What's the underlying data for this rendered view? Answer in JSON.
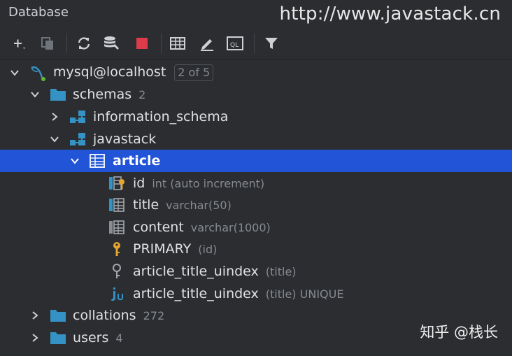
{
  "window": {
    "title": "Database",
    "watermark": "http://www.javastack.cn"
  },
  "toolbar": {
    "buttons": [
      {
        "icon": "plus-icon"
      },
      {
        "icon": "duplicate-icon"
      },
      {
        "icon": "refresh-icon"
      },
      {
        "icon": "data-source-properties-icon"
      },
      {
        "icon": "stop-icon"
      },
      {
        "icon": "table-view-icon"
      },
      {
        "icon": "edit-icon"
      },
      {
        "icon": "query-console-icon"
      },
      {
        "icon": "filter-icon"
      }
    ]
  },
  "tree": {
    "connection": {
      "label": "mysql@localhost",
      "badge": "2 of 5"
    },
    "schemas": {
      "label": "schemas",
      "count": "2"
    },
    "information_schema": {
      "label": "information_schema"
    },
    "javastack": {
      "label": "javastack"
    },
    "article": {
      "label": "article"
    },
    "columns": [
      {
        "name": "id",
        "type": "int (auto increment)"
      },
      {
        "name": "title",
        "type": "varchar(50)"
      },
      {
        "name": "content",
        "type": "varchar(1000)"
      }
    ],
    "primary": {
      "name": "PRIMARY",
      "detail": "(id)"
    },
    "key": {
      "name": "article_title_uindex",
      "detail": "(title)"
    },
    "index": {
      "name": "article_title_uindex",
      "detail": "(title) UNIQUE"
    },
    "collations": {
      "label": "collations",
      "count": "272"
    },
    "users": {
      "label": "users",
      "count": "4"
    }
  },
  "footer": {
    "watermark": "知乎 @栈长"
  },
  "colors": {
    "selection": "#2154d6",
    "folder": "#3592c4",
    "key": "#e5a52f"
  }
}
